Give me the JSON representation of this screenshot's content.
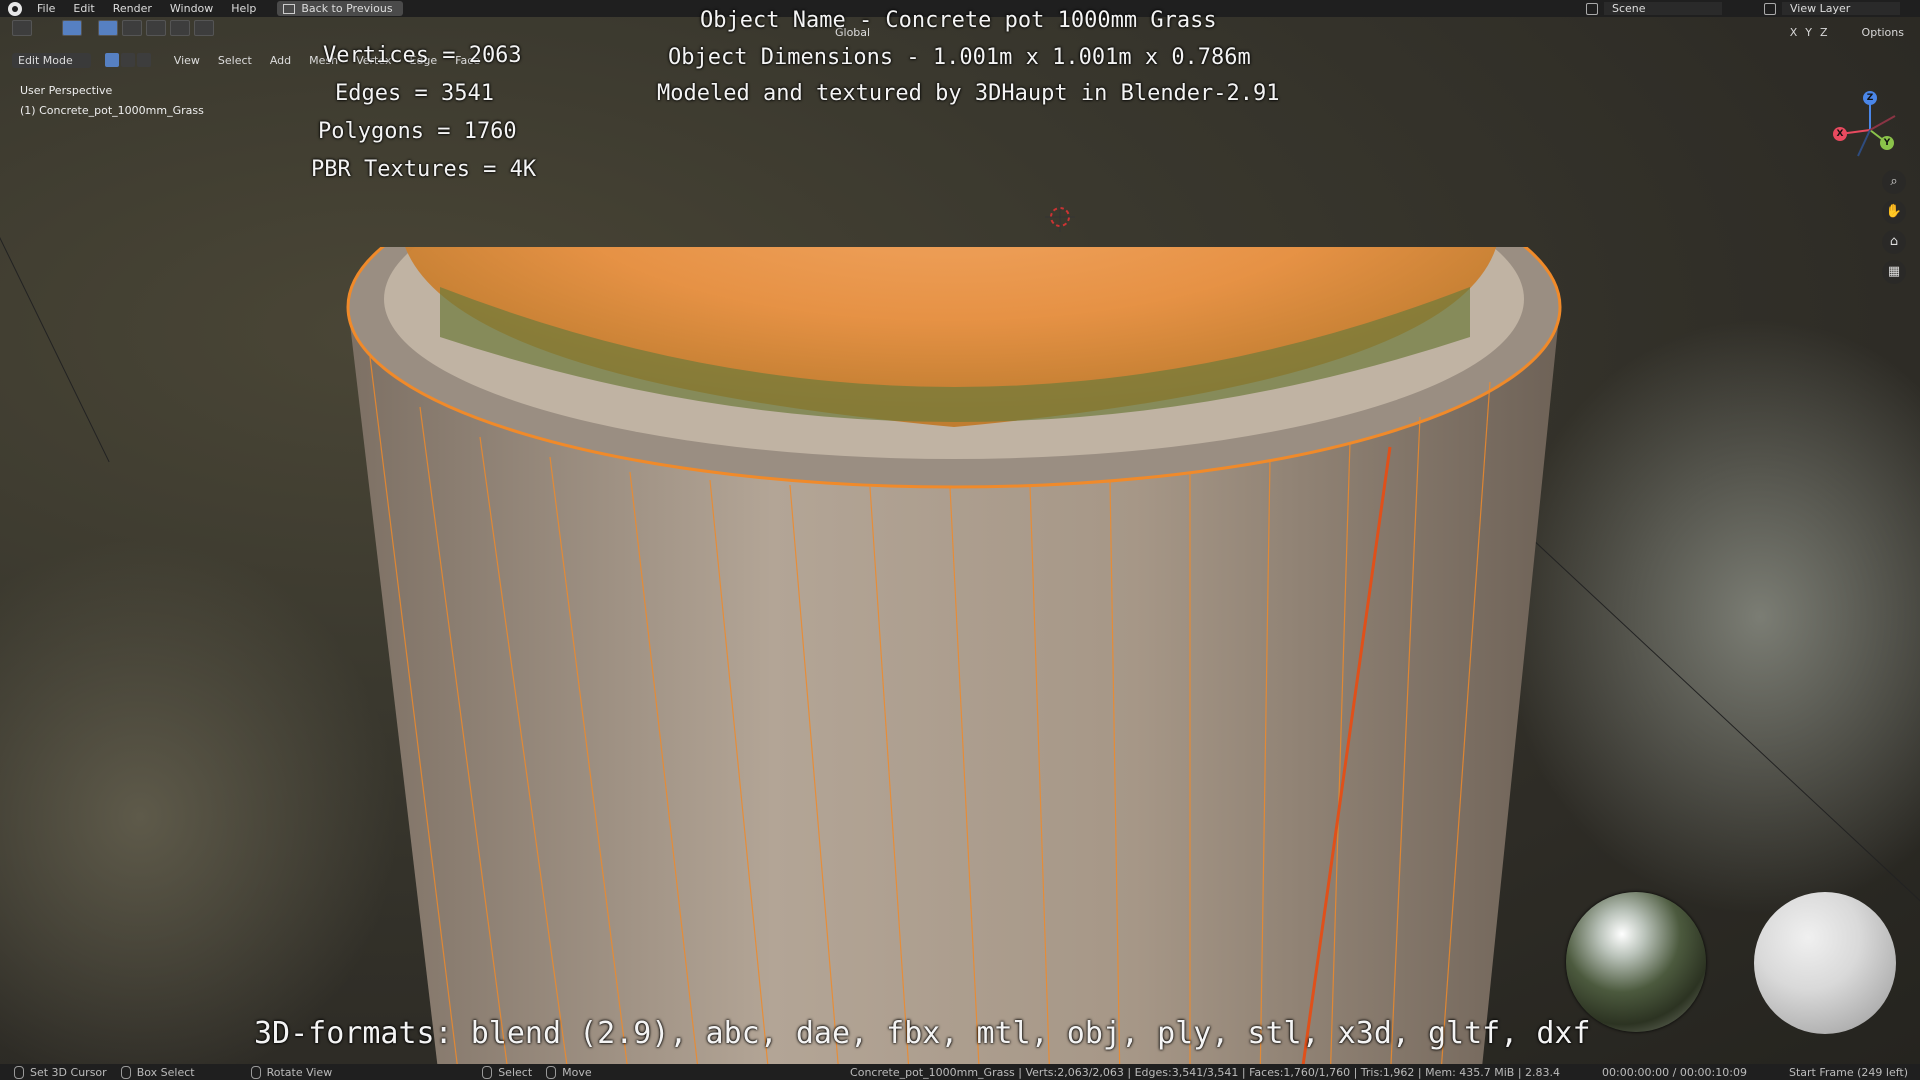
{
  "topbar": {
    "menus": [
      "File",
      "Edit",
      "Render",
      "Window",
      "Help"
    ],
    "back_button": "Back to Previous",
    "scene": "Scene",
    "view_layer": "View Layer"
  },
  "header": {
    "transform_orientation": "Global",
    "axes": [
      "X",
      "Y",
      "Z"
    ],
    "options": "Options"
  },
  "mode_row": {
    "mode": "Edit Mode",
    "menus": [
      "View",
      "Select",
      "Add",
      "Mesh",
      "Vertex",
      "Edge",
      "Face"
    ]
  },
  "viewport": {
    "perspective": "User Perspective",
    "object": "(1) Concrete_pot_1000mm_Grass"
  },
  "overlay": {
    "vertices": "Vertices = 2063",
    "edges": "Edges = 3541",
    "polygons": "Polygons = 1760",
    "textures": "PBR Textures = 4K",
    "object_name": "Object Name - Concrete pot 1000mm Grass",
    "dimensions": "Object Dimensions -  1.001m x 1.001m x 0.786m",
    "credit": "Modeled and textured by 3DHaupt in Blender-2.91",
    "formats": "3D-formats: blend (2.9), abc, dae, fbx, mtl, obj, ply, stl, x3d, gltf, dxf"
  },
  "gizmo": {
    "x": "X",
    "y": "Y",
    "z": "Z"
  },
  "statusbar": {
    "hint1": "Set 3D Cursor",
    "hint2": "Box Select",
    "hint3": "Rotate View",
    "hint4": "Select",
    "hint5": "Move",
    "stats": "Concrete_pot_1000mm_Grass | Verts:2,063/2,063 | Edges:3,541/3,541 | Faces:1,760/1,760 | Tris:1,962 | Mem: 435.7 MiB | 2.83.4",
    "time": "00:00:00:00 / 00:00:10:09",
    "frame": "Start Frame (249 left)"
  },
  "colors": {
    "selection_orange": "#f0902a",
    "concrete": "#a99a8c",
    "grass": "#6d7a3a"
  }
}
